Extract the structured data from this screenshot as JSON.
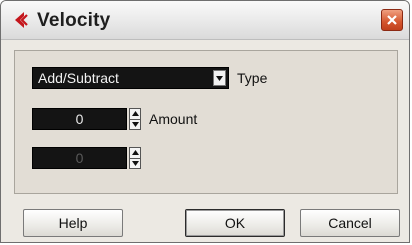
{
  "window": {
    "title": "Velocity"
  },
  "form": {
    "type_value": "Add/Subtract",
    "type_label": "Type",
    "amount_value": "0",
    "amount_label": "Amount",
    "second_value": "0"
  },
  "buttons": {
    "help": "Help",
    "ok": "OK",
    "cancel": "Cancel"
  },
  "colors": {
    "field_bg": "#141414",
    "close_button": "#d4562e",
    "logo_red": "#c4161c"
  }
}
